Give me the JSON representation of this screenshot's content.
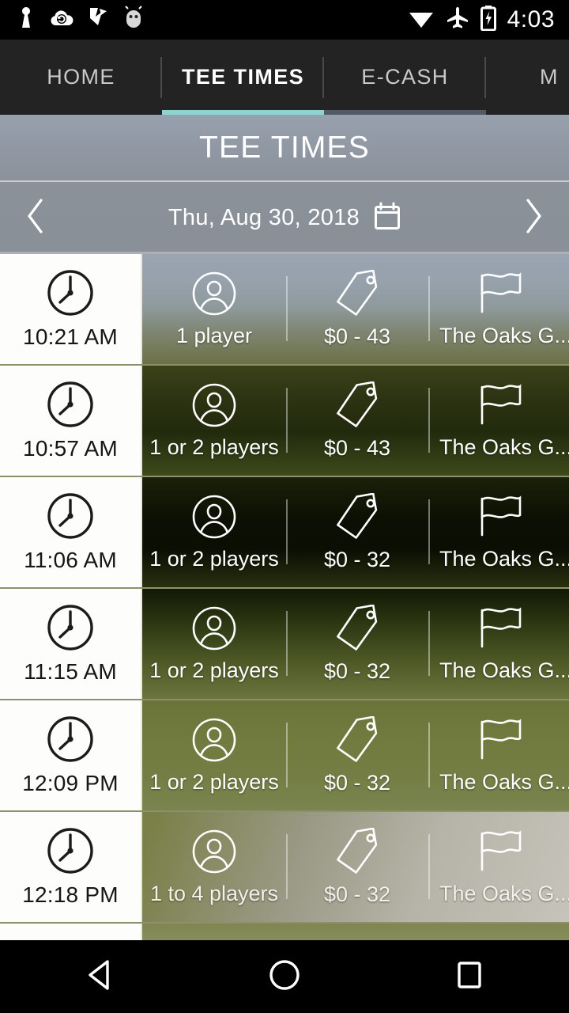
{
  "status_bar": {
    "time": "4:03",
    "left_icons": [
      "usb-keyhole-icon",
      "cloud-sync-icon",
      "check-flag-icon",
      "android-robot-icon"
    ],
    "right_icons": [
      "wifi-icon",
      "airplane-mode-icon",
      "battery-charging-icon"
    ]
  },
  "tabs": [
    {
      "label": "HOME",
      "active": false
    },
    {
      "label": "TEE TIMES",
      "active": true
    },
    {
      "label": "E-CASH",
      "active": false
    },
    {
      "label": "M",
      "active": false
    }
  ],
  "header": {
    "title": "TEE TIMES",
    "date": "Thu, Aug 30, 2018",
    "calendar_icon": "calendar-icon",
    "prev_icon": "chevron-left-icon",
    "next_icon": "chevron-right-icon"
  },
  "colors": {
    "accent_teal": "#8fd2d2",
    "header_grey": "#8b9199",
    "status_bar": "#000000",
    "tab_bar": "#232323",
    "time_cell": "#fdfdfb",
    "row_divider": "#8d9068"
  },
  "tee_times": [
    {
      "time": "10:21 AM",
      "players": "1 player",
      "price": "$0 - 43",
      "course": "The Oaks G..."
    },
    {
      "time": "10:57 AM",
      "players": "1 or 2 players",
      "price": "$0 - 43",
      "course": "The Oaks G..."
    },
    {
      "time": "11:06 AM",
      "players": "1 or 2 players",
      "price": "$0 - 32",
      "course": "The Oaks G..."
    },
    {
      "time": "11:15 AM",
      "players": "1 or 2 players",
      "price": "$0 - 32",
      "course": "The Oaks G..."
    },
    {
      "time": "12:09 PM",
      "players": "1 or 2 players",
      "price": "$0 - 32",
      "course": "The Oaks G..."
    },
    {
      "time": "12:18 PM",
      "players": "1 to 4 players",
      "price": "$0 - 32",
      "course": "The Oaks G..."
    }
  ],
  "row_icons": {
    "time": "clock-icon",
    "players": "person-icon",
    "price": "price-tag-icon",
    "course": "flag-icon"
  },
  "nav_bar": {
    "back": "back-triangle-icon",
    "home": "home-circle-icon",
    "recents": "recents-square-icon"
  }
}
